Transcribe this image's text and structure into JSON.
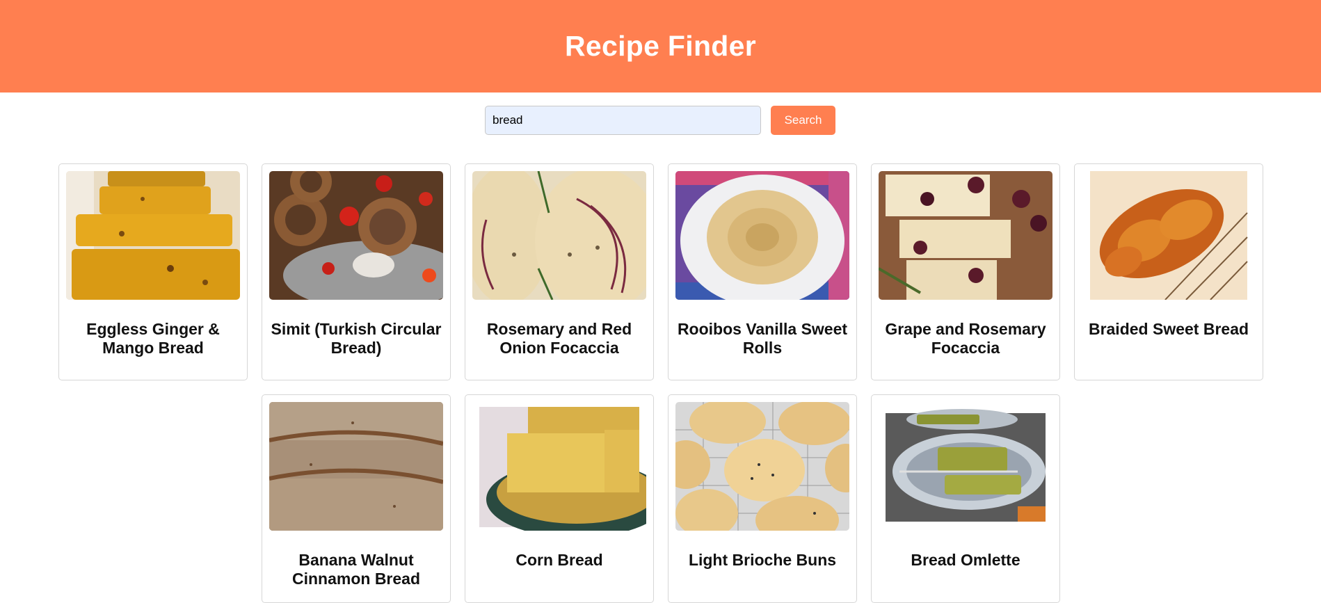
{
  "header": {
    "title": "Recipe Finder"
  },
  "search": {
    "value": "bread",
    "button_label": "Search"
  },
  "colors": {
    "accent": "#ff7f50",
    "input_background": "#e8f0fe"
  },
  "recipes": [
    {
      "title": "Eggless Ginger & Mango Bread",
      "image": "sliced-mango-bread-photo"
    },
    {
      "title": "Simit (Turkish Circular Bread)",
      "image": "simit-rings-photo"
    },
    {
      "title": "Rosemary and Red Onion Focaccia",
      "image": "focaccia-photo"
    },
    {
      "title": "Rooibos Vanilla Sweet Rolls",
      "image": "sweet-roll-photo"
    },
    {
      "title": "Grape and Rosemary Focaccia",
      "image": "grape-focaccia-photo"
    },
    {
      "title": "Braided Sweet Bread",
      "image": "braided-bread-photo"
    },
    {
      "title": "Banana Walnut Cinnamon Bread",
      "image": "banana-bread-photo"
    },
    {
      "title": "Corn Bread",
      "image": "corn-bread-photo"
    },
    {
      "title": "Light Brioche Buns",
      "image": "brioche-buns-photo"
    },
    {
      "title": "Bread Omlette",
      "image": "bread-omlette-photo"
    }
  ]
}
